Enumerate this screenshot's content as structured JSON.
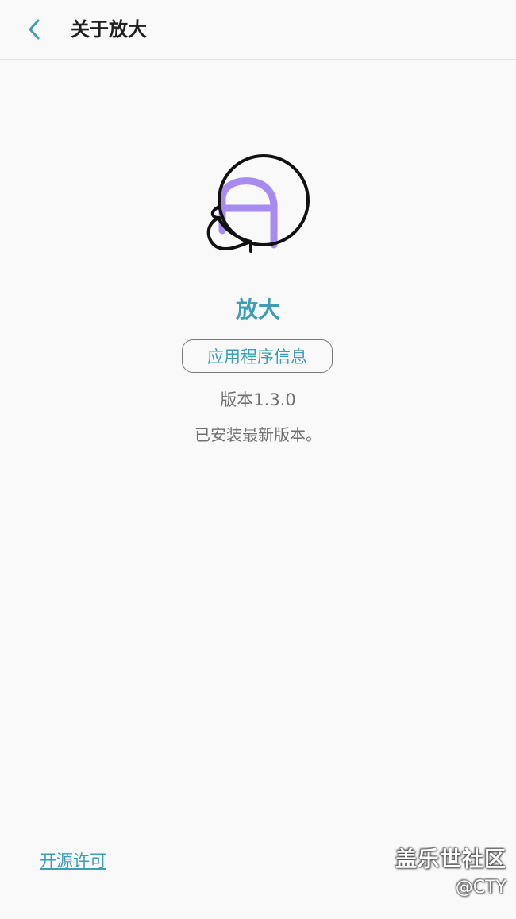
{
  "header": {
    "title": "关于放大",
    "back_icon": "chevron-left-icon"
  },
  "app": {
    "icon": "magnifier-app-icon",
    "name": "放大",
    "info_button_label": "应用程序信息",
    "version": "版本1.3.0",
    "status": "已安装最新版本。"
  },
  "footer": {
    "license_link": "开源许可"
  },
  "watermark": {
    "title": "盖乐世社区",
    "handle": "@CTY"
  },
  "colors": {
    "accent": "#3d9db5",
    "background": "#f9f9fa",
    "icon_letter": "#a78bf0",
    "secondary_text": "#707070"
  }
}
